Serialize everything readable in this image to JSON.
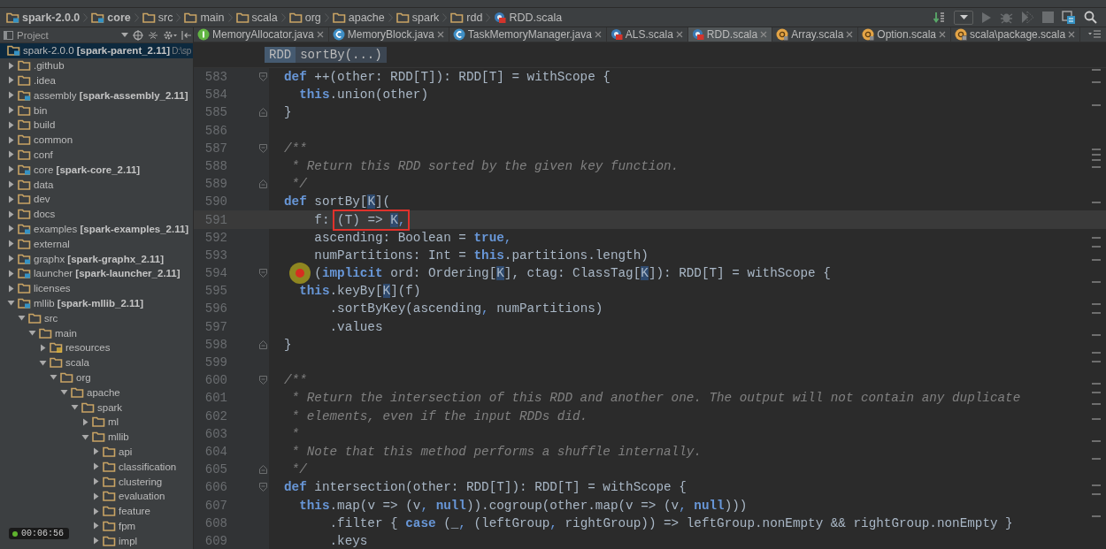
{
  "navbar": {
    "items": [
      {
        "label": "spark-2.0.0",
        "kind": "module"
      },
      {
        "label": "core",
        "kind": "module"
      },
      {
        "label": "src",
        "kind": "folder"
      },
      {
        "label": "main",
        "kind": "folder"
      },
      {
        "label": "scala",
        "kind": "folder"
      },
      {
        "label": "org",
        "kind": "folder"
      },
      {
        "label": "apache",
        "kind": "folder"
      },
      {
        "label": "spark",
        "kind": "folder"
      },
      {
        "label": "rdd",
        "kind": "folder"
      },
      {
        "label": "RDD.scala",
        "kind": "scala"
      }
    ]
  },
  "project_panel": {
    "title": "Project",
    "tree": [
      {
        "label": "spark-2.0.0 **[spark-parent_2.11]**",
        "path": "D:\\sp",
        "kind": "module",
        "selected": true,
        "children": [
          {
            "label": ".github",
            "kind": "folder",
            "expanded": false,
            "selected": false
          },
          {
            "label": ".idea",
            "kind": "folder",
            "expanded": false,
            "selected": false
          },
          {
            "label": "assembly **[spark-assembly_2.11]**",
            "kind": "module",
            "expanded": false,
            "selected": false
          },
          {
            "label": "bin",
            "kind": "folder",
            "expanded": false,
            "selected": false
          },
          {
            "label": "build",
            "kind": "folder",
            "expanded": false,
            "selected": false
          },
          {
            "label": "common",
            "kind": "folder",
            "expanded": false,
            "selected": false
          },
          {
            "label": "conf",
            "kind": "folder",
            "expanded": false,
            "selected": false
          },
          {
            "label": "core **[spark-core_2.11]**",
            "kind": "module",
            "expanded": false,
            "selected": false
          },
          {
            "label": "data",
            "kind": "folder",
            "expanded": false,
            "selected": false
          },
          {
            "label": "dev",
            "kind": "folder",
            "expanded": false,
            "selected": false
          },
          {
            "label": "docs",
            "kind": "folder",
            "expanded": false,
            "selected": false
          },
          {
            "label": "examples **[spark-examples_2.11]**",
            "kind": "module",
            "expanded": false,
            "selected": false
          },
          {
            "label": "external",
            "kind": "folder",
            "expanded": false,
            "selected": false
          },
          {
            "label": "graphx **[spark-graphx_2.11]**",
            "kind": "module",
            "expanded": false,
            "selected": false
          },
          {
            "label": "launcher **[spark-launcher_2.11]**",
            "kind": "module",
            "expanded": false,
            "selected": false
          },
          {
            "label": "licenses",
            "kind": "folder",
            "expanded": false,
            "selected": false
          },
          {
            "label": "mllib **[spark-mllib_2.11]**",
            "kind": "module",
            "expanded": true,
            "selected": false,
            "children": [
              {
                "label": "src",
                "kind": "folder",
                "expanded": true,
                "selected": false,
                "children": [
                  {
                    "label": "main",
                    "kind": "folder",
                    "expanded": true,
                    "selected": false,
                    "children": [
                      {
                        "label": "resources",
                        "kind": "resources",
                        "expanded": false,
                        "selected": false
                      },
                      {
                        "label": "scala",
                        "kind": "folder",
                        "expanded": true,
                        "selected": false,
                        "children": [
                          {
                            "label": "org",
                            "kind": "folder",
                            "expanded": true,
                            "selected": false,
                            "children": [
                              {
                                "label": "apache",
                                "kind": "folder",
                                "expanded": true,
                                "selected": false,
                                "children": [
                                  {
                                    "label": "spark",
                                    "kind": "folder",
                                    "expanded": true,
                                    "selected": false,
                                    "children": [
                                      {
                                        "label": "ml",
                                        "kind": "folder",
                                        "expanded": false,
                                        "selected": false
                                      },
                                      {
                                        "label": "mllib",
                                        "kind": "folder",
                                        "expanded": true,
                                        "selected": false,
                                        "children": [
                                          {
                                            "label": "api",
                                            "kind": "folder",
                                            "expanded": false,
                                            "selected": false
                                          },
                                          {
                                            "label": "classification",
                                            "kind": "folder",
                                            "expanded": false,
                                            "selected": false
                                          },
                                          {
                                            "label": "clustering",
                                            "kind": "folder",
                                            "expanded": false,
                                            "selected": false
                                          },
                                          {
                                            "label": "evaluation",
                                            "kind": "folder",
                                            "expanded": false,
                                            "selected": false
                                          },
                                          {
                                            "label": "feature",
                                            "kind": "folder",
                                            "expanded": false,
                                            "selected": false
                                          },
                                          {
                                            "label": "fpm",
                                            "kind": "folder",
                                            "expanded": false,
                                            "selected": false
                                          },
                                          {
                                            "label": "impl",
                                            "kind": "folder",
                                            "expanded": false,
                                            "selected": false
                                          }
                                        ]
                                      }
                                    ]
                                  }
                                ]
                              }
                            ]
                          }
                        ]
                      }
                    ]
                  }
                ]
              }
            ]
          }
        ]
      }
    ]
  },
  "tabs": [
    {
      "label": "MemoryAllocator.java",
      "kind": "interface",
      "selected": false
    },
    {
      "label": "MemoryBlock.java",
      "kind": "class",
      "selected": false
    },
    {
      "label": "TaskMemoryManager.java",
      "kind": "class",
      "selected": false
    },
    {
      "label": "ALS.scala",
      "kind": "scala",
      "selected": false
    },
    {
      "label": "RDD.scala",
      "kind": "scala",
      "selected": true
    },
    {
      "label": "Array.scala",
      "kind": "object",
      "selected": false
    },
    {
      "label": "Option.scala",
      "kind": "object",
      "selected": false
    },
    {
      "label": "scala\\package.scala",
      "kind": "package",
      "selected": false
    }
  ],
  "editor": {
    "breadcrumb": [
      "RDD",
      "sortBy(...)"
    ],
    "lines": [
      {
        "number": "583",
        "fold_start": true,
        "fold_end": false,
        "current": false,
        "breakpoint": false,
        "tokens": [
          {
            "kind": "keyword",
            "text": "def"
          },
          {
            "kind": "plain",
            "text": " ++(other: RDD[T]): RDD[T] = withScope {"
          }
        ]
      },
      {
        "number": "584",
        "fold_start": false,
        "fold_end": false,
        "current": false,
        "breakpoint": false,
        "tokens": [
          {
            "kind": "keyword",
            "text": "  this"
          },
          {
            "kind": "plain",
            "text": ".union(other)"
          }
        ]
      },
      {
        "number": "585",
        "fold_start": false,
        "fold_end": true,
        "current": false,
        "breakpoint": false,
        "tokens": [
          {
            "kind": "plain",
            "text": "}"
          }
        ]
      },
      {
        "number": "586",
        "fold_start": false,
        "fold_end": false,
        "current": false,
        "breakpoint": false
      },
      {
        "number": "587",
        "fold_start": true,
        "fold_end": false,
        "current": false,
        "breakpoint": false,
        "tokens": [
          {
            "kind": "comment",
            "text": "/**"
          }
        ]
      },
      {
        "number": "588",
        "fold_start": false,
        "fold_end": false,
        "current": false,
        "breakpoint": false,
        "tokens": [
          {
            "kind": "comment",
            "text": " * Return this RDD sorted by the given key function."
          }
        ]
      },
      {
        "number": "589",
        "fold_start": false,
        "fold_end": true,
        "current": false,
        "breakpoint": false,
        "tokens": [
          {
            "kind": "comment",
            "text": " */"
          }
        ]
      },
      {
        "number": "590",
        "fold_start": false,
        "fold_end": false,
        "current": false,
        "breakpoint": false,
        "tokens": [
          {
            "kind": "keyword",
            "text": "def"
          },
          {
            "kind": "plain",
            "text": " sortBy["
          },
          {
            "kind": "param",
            "text": "K"
          },
          {
            "kind": "plain",
            "text": "]("
          }
        ]
      },
      {
        "number": "591",
        "fold_start": false,
        "fold_end": false,
        "current": true,
        "breakpoint": false,
        "tokens": [
          {
            "kind": "plain",
            "text": "    f: "
          },
          {
            "kind": "box",
            "tokens": [
              {
                "kind": "plain",
                "text": "(T) => "
              },
              {
                "kind": "param",
                "text": "K"
              },
              {
                "kind": "punct",
                "text": ","
              }
            ]
          }
        ]
      },
      {
        "number": "592",
        "fold_start": false,
        "fold_end": false,
        "current": false,
        "breakpoint": false,
        "tokens": [
          {
            "kind": "plain",
            "text": "    ascending: Boolean = "
          },
          {
            "kind": "keyword",
            "text": "true"
          },
          {
            "kind": "punct",
            "text": ","
          }
        ]
      },
      {
        "number": "593",
        "fold_start": false,
        "fold_end": false,
        "current": false,
        "breakpoint": false,
        "tokens": [
          {
            "kind": "plain",
            "text": "    numPartitions: Int = "
          },
          {
            "kind": "keyword",
            "text": "this"
          },
          {
            "kind": "plain",
            "text": ".partitions.length)"
          }
        ]
      },
      {
        "number": "594",
        "fold_start": true,
        "fold_end": false,
        "current": false,
        "breakpoint": true,
        "tokens": [
          {
            "kind": "plain",
            "text": "    ("
          },
          {
            "kind": "keyword",
            "text": "implicit"
          },
          {
            "kind": "plain",
            "text": " ord: Ordering["
          },
          {
            "kind": "param",
            "text": "K"
          },
          {
            "kind": "plain",
            "text": "], ctag: ClassTag["
          },
          {
            "kind": "param",
            "text": "K"
          },
          {
            "kind": "plain",
            "text": "]): RDD[T] = withScope {"
          }
        ]
      },
      {
        "number": "595",
        "fold_start": false,
        "fold_end": false,
        "current": false,
        "breakpoint": false,
        "tokens": [
          {
            "kind": "keyword",
            "text": "  this"
          },
          {
            "kind": "plain",
            "text": ".keyBy["
          },
          {
            "kind": "param",
            "text": "K"
          },
          {
            "kind": "plain",
            "text": "](f)"
          }
        ]
      },
      {
        "number": "596",
        "fold_start": false,
        "fold_end": false,
        "current": false,
        "breakpoint": false,
        "tokens": [
          {
            "kind": "plain",
            "text": "      .sortByKey(ascending"
          },
          {
            "kind": "punct",
            "text": ","
          },
          {
            "kind": "plain",
            "text": " numPartitions)"
          }
        ]
      },
      {
        "number": "597",
        "fold_start": false,
        "fold_end": false,
        "current": false,
        "breakpoint": false,
        "tokens": [
          {
            "kind": "plain",
            "text": "      .values"
          }
        ]
      },
      {
        "number": "598",
        "fold_start": false,
        "fold_end": true,
        "current": false,
        "breakpoint": false,
        "tokens": [
          {
            "kind": "plain",
            "text": "}"
          }
        ]
      },
      {
        "number": "599",
        "fold_start": false,
        "fold_end": false,
        "current": false,
        "breakpoint": false
      },
      {
        "number": "600",
        "fold_start": true,
        "fold_end": false,
        "current": false,
        "breakpoint": false,
        "tokens": [
          {
            "kind": "comment",
            "text": "/**"
          }
        ]
      },
      {
        "number": "601",
        "fold_start": false,
        "fold_end": false,
        "current": false,
        "breakpoint": false,
        "tokens": [
          {
            "kind": "comment",
            "text": " * Return the intersection of this RDD and another one. The output will not contain any duplicate"
          }
        ]
      },
      {
        "number": "602",
        "fold_start": false,
        "fold_end": false,
        "current": false,
        "breakpoint": false,
        "tokens": [
          {
            "kind": "comment",
            "text": " * elements, even if the input RDDs did."
          }
        ]
      },
      {
        "number": "603",
        "fold_start": false,
        "fold_end": false,
        "current": false,
        "breakpoint": false,
        "tokens": [
          {
            "kind": "comment",
            "text": " *"
          }
        ]
      },
      {
        "number": "604",
        "fold_start": false,
        "fold_end": false,
        "current": false,
        "breakpoint": false,
        "tokens": [
          {
            "kind": "comment",
            "text": " * Note that this method performs a shuffle internally."
          }
        ]
      },
      {
        "number": "605",
        "fold_start": false,
        "fold_end": true,
        "current": false,
        "breakpoint": false,
        "tokens": [
          {
            "kind": "comment",
            "text": " */"
          }
        ]
      },
      {
        "number": "606",
        "fold_start": true,
        "fold_end": false,
        "current": false,
        "breakpoint": false,
        "tokens": [
          {
            "kind": "keyword",
            "text": "def"
          },
          {
            "kind": "plain",
            "text": " intersection(other: RDD[T]): RDD[T] = withScope {"
          }
        ]
      },
      {
        "number": "607",
        "fold_start": false,
        "fold_end": false,
        "current": false,
        "breakpoint": false,
        "tokens": [
          {
            "kind": "keyword",
            "text": "  this"
          },
          {
            "kind": "plain",
            "text": ".map(v => (v"
          },
          {
            "kind": "punct",
            "text": ", "
          },
          {
            "kind": "keyword",
            "text": "null"
          },
          {
            "kind": "plain",
            "text": ")).cogroup(other.map(v => (v"
          },
          {
            "kind": "punct",
            "text": ", "
          },
          {
            "kind": "keyword",
            "text": "null"
          },
          {
            "kind": "plain",
            "text": ")))"
          }
        ]
      },
      {
        "number": "608",
        "fold_start": false,
        "fold_end": false,
        "current": false,
        "breakpoint": false,
        "tokens": [
          {
            "kind": "plain",
            "text": "      .filter { "
          },
          {
            "kind": "keyword",
            "text": "case"
          },
          {
            "kind": "plain",
            "text": " (_"
          },
          {
            "kind": "punct",
            "text": ","
          },
          {
            "kind": "plain",
            "text": " (leftGroup"
          },
          {
            "kind": "punct",
            "text": ","
          },
          {
            "kind": "plain",
            "text": " rightGroup)) => leftGroup.nonEmpty && rightGroup.nonEmpty }"
          }
        ]
      },
      {
        "number": "609",
        "fold_start": false,
        "fold_end": false,
        "current": false,
        "breakpoint": false,
        "tokens": [
          {
            "kind": "plain",
            "text": "      .keys"
          }
        ]
      }
    ]
  },
  "video_overlay": {
    "time": "00:06:56"
  }
}
